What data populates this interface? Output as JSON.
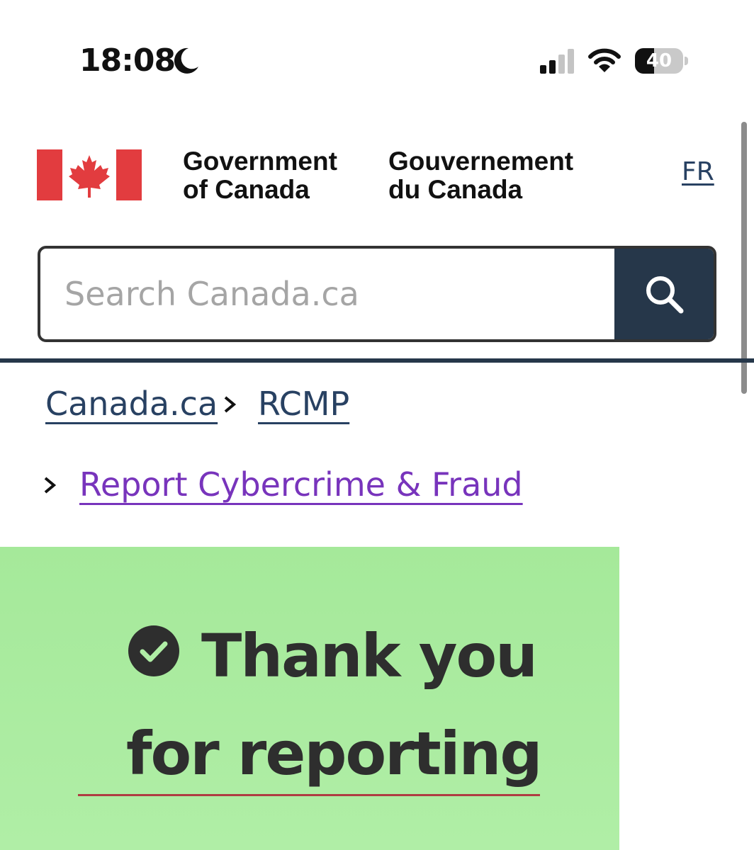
{
  "status_bar": {
    "time": "18:08",
    "focus_icon": "moon-icon",
    "signal_icon": "cellular-signal-icon",
    "wifi_icon": "wifi-icon",
    "battery_level": 40,
    "battery_label": "40"
  },
  "header": {
    "signature_en": [
      "Government",
      "of Canada"
    ],
    "signature_fr": [
      "Gouvernement",
      "du Canada"
    ],
    "language_toggle": "FR",
    "flag_icon": "canada-flag-icon",
    "colors": {
      "flag_red": "#e23c3f",
      "header_rule": "#26374a"
    }
  },
  "search": {
    "placeholder": "Search Canada.ca",
    "button_icon": "search-icon",
    "button_color": "#26374a"
  },
  "breadcrumb": {
    "items": [
      "Canada.ca",
      "RCMP",
      "Report Cybercrime & Fraud"
    ],
    "link_color": "#284162",
    "visited_link_color": "#7834bc"
  },
  "success": {
    "icon": "check-circle-icon",
    "title_line_1": "Thank you",
    "title_line_2": "for reporting",
    "background_color": "#a8eb9c",
    "rule_color": "#af3c43"
  }
}
